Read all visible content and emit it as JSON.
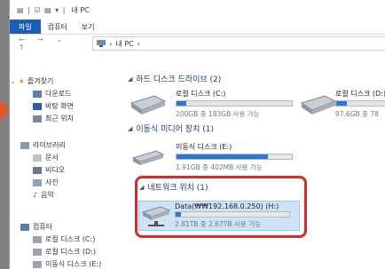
{
  "window": {
    "title": "내 PC",
    "quick_access": "▤ | ☑ ▤ ▾ |"
  },
  "ribbon": {
    "tabs": [
      "파일",
      "컴퓨터",
      "보기"
    ]
  },
  "address": {
    "nav": "← → ⌄ ↑",
    "path": [
      "내 PC"
    ]
  },
  "sidebar": {
    "favorites": {
      "label": "즐겨찾기",
      "items": [
        "다운로드",
        "바탕 화면",
        "최근 위치"
      ]
    },
    "libraries": {
      "label": "라이브러리",
      "items": [
        "문서",
        "비디오",
        "사진",
        "음악"
      ]
    },
    "computer": {
      "label": "컴퓨터",
      "items": [
        "로컬 디스크 (C:)",
        "로컬 디스크 (D:)",
        "이동식 디스크 (E:)"
      ]
    }
  },
  "sections": {
    "hdd": {
      "header": "하드 디스크 드라이브 (2)",
      "drives": [
        {
          "name": "로컬 디스크 (C:)",
          "size": "200GB 중 183GB 사용 가능",
          "used": 0.085
        },
        {
          "name": "로컬 디스크 (D:)",
          "size": "97.6GB 중 78",
          "used": 0.2
        }
      ]
    },
    "removable": {
      "header": "이동식 미디어 장치 (1)",
      "drives": [
        {
          "name": "이동식 디스크 (E:)",
          "size": "1.91GB 중 402MB 사용 가능",
          "used": 0.79
        }
      ]
    },
    "network": {
      "header": "네트워크 위치 (1)",
      "drives": [
        {
          "name": "Data(₩₩192.168.0.250) (H:)",
          "size": "2.81TB 중 2.67TB 사용 가능",
          "used": 0.05
        }
      ]
    }
  },
  "colors": {
    "accent": "#1a5fb4",
    "bar": "#2779d6",
    "highlight": "#d52b2b",
    "arrow": "#e4572e"
  }
}
